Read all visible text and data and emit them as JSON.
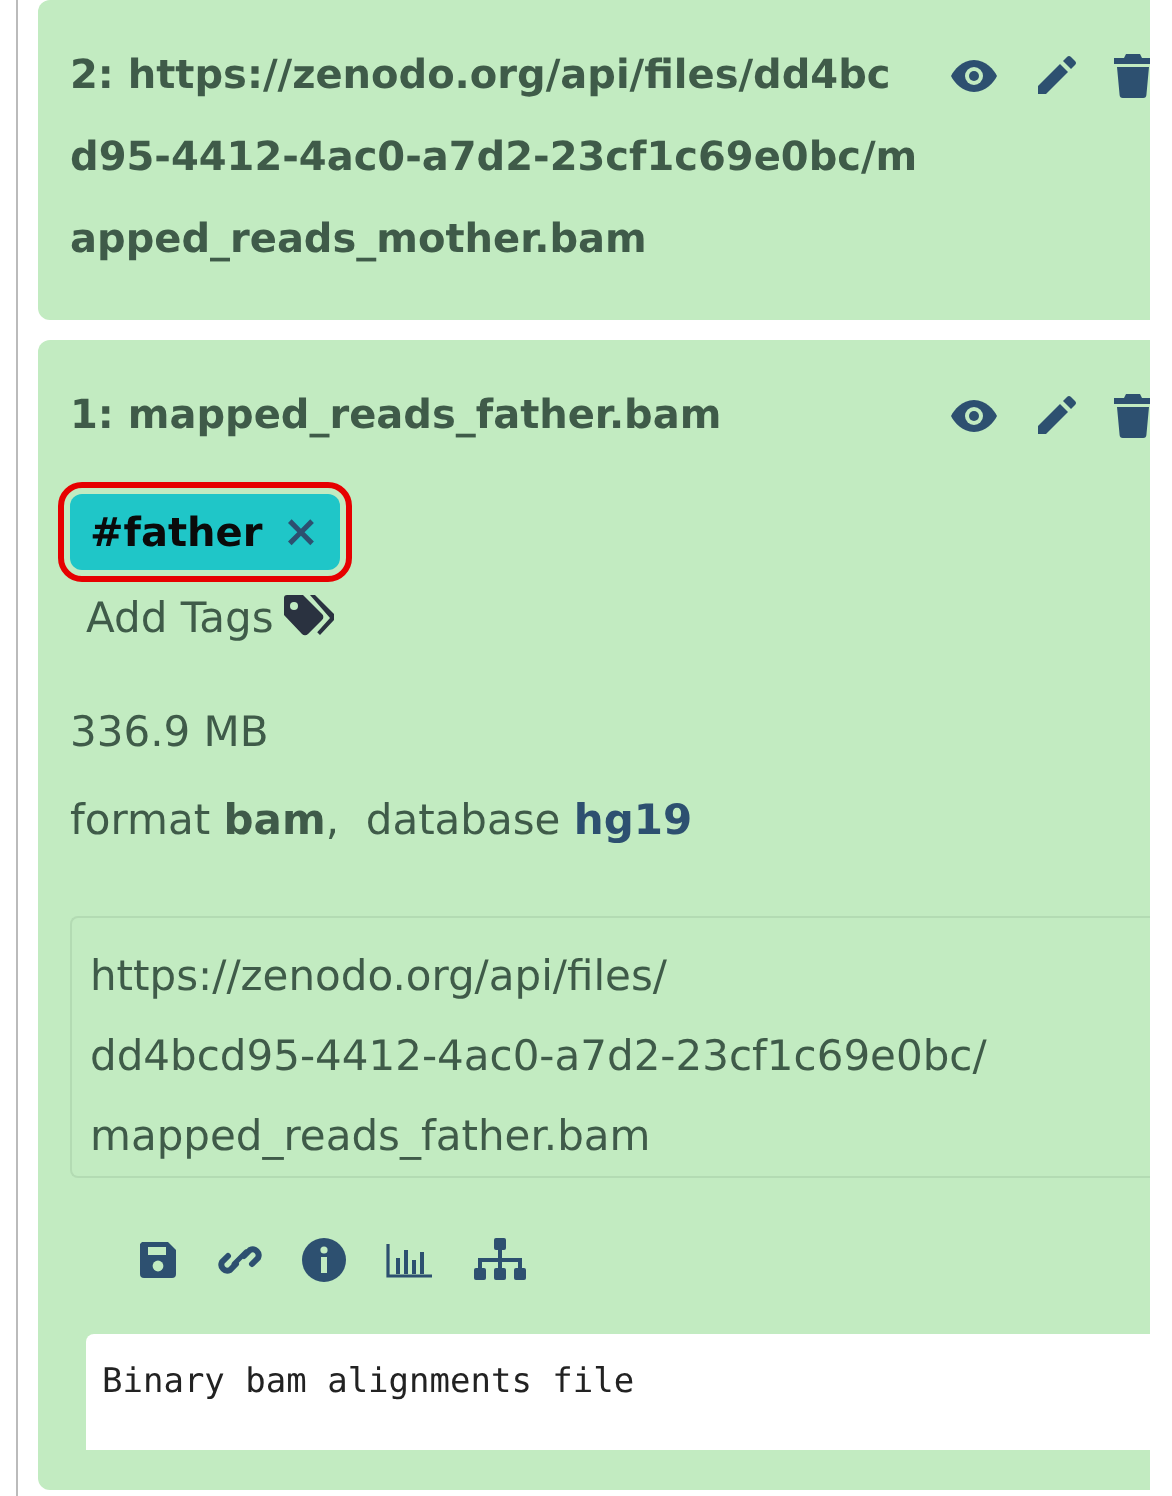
{
  "datasets": [
    {
      "title": "2: https://zenodo.org/api/files/dd4bcd95-4412-4ac0-a7d2-23cf1c69e0bc/mapped_reads_mother.bam",
      "expanded": false
    },
    {
      "title": "1: mapped_reads_father.bam",
      "expanded": true,
      "tags": [
        {
          "label": "#father",
          "remove": "×",
          "highlighted": true
        }
      ],
      "add_tags": "Add Tags",
      "size": "336.9 MB",
      "format_label": "format",
      "format": "bam",
      "separator": ",",
      "database_label": "database",
      "database": "hg19",
      "url": "https://zenodo.org/api/files/dd4bcd95-4412-4ac0-a7d2-23cf1c69e0bc/mapped_reads_father.bam",
      "peek": "Binary bam alignments file"
    }
  ]
}
